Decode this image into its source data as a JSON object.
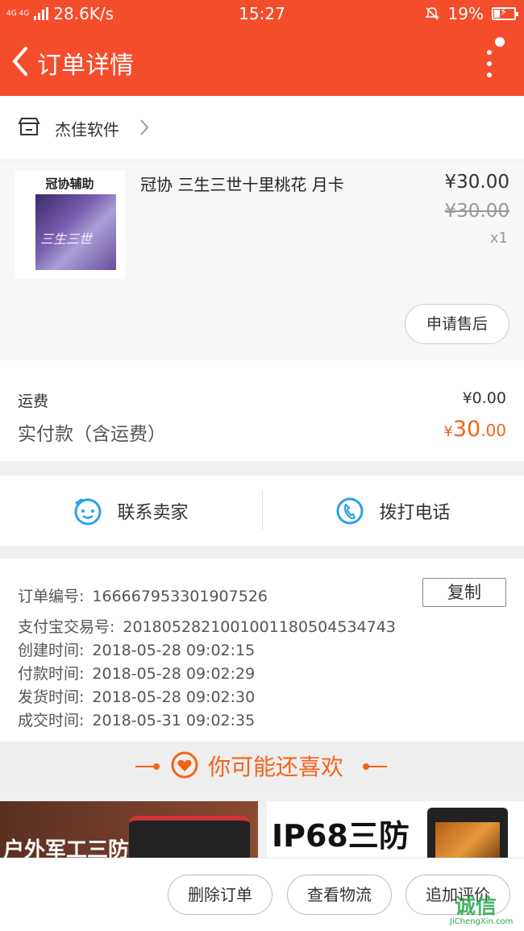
{
  "status": {
    "network": "4G 4G",
    "speed": "28.6K/s",
    "time": "15:27",
    "battery": "19%"
  },
  "header": {
    "title": "订单详情"
  },
  "shop": {
    "name": "杰佳软件"
  },
  "product": {
    "thumb_caption": "冠协辅助",
    "thumb_art_text": "三生三世",
    "name": "冠协 三生三世十里桃花 月卡",
    "price": "¥30.00",
    "original_price": "¥30.00",
    "quantity": "x1",
    "after_sale_label": "申请售后"
  },
  "fees": {
    "shipping_label": "运费",
    "shipping_value": "¥0.00",
    "paid_label": "实付款（含运费）",
    "paid_currency": "¥",
    "paid_int": "30",
    "paid_dec": ".00"
  },
  "contact": {
    "seller_label": "联系卖家",
    "phone_label": "拨打电话"
  },
  "order_info": {
    "copy_label": "复制",
    "rows": [
      {
        "key": "订单编号:",
        "value": "166667953301907526"
      },
      {
        "key": "支付宝交易号:",
        "value": "2018052821001001180504534743"
      },
      {
        "key": "创建时间:",
        "value": "2018-05-28 09:02:15"
      },
      {
        "key": "付款时间:",
        "value": "2018-05-28 09:02:29"
      },
      {
        "key": "发货时间:",
        "value": "2018-05-28 09:02:30"
      },
      {
        "key": "成交时间:",
        "value": "2018-05-31 09:02:35"
      }
    ]
  },
  "recommend": {
    "title": "你可能还喜欢"
  },
  "banners": {
    "left_text": "户外军工三防",
    "right_text": "IP68三防"
  },
  "actions": {
    "delete": "删除订单",
    "logistics": "查看物流",
    "review": "追加评价"
  },
  "watermark": {
    "logo": "诚信",
    "sub": "JiChengXin.com"
  },
  "colors": {
    "brand": "#f44d2c",
    "accent": "#f26419",
    "contact_icon": "#29a3e8"
  }
}
